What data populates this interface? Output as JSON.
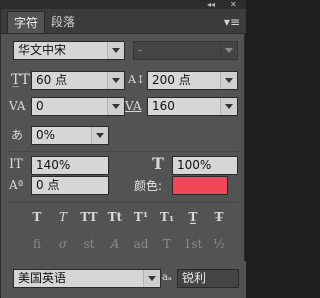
{
  "window": {
    "collapse_glyph": "◂◂",
    "close_glyph": "✕",
    "menu_glyph": "▾≡"
  },
  "tabs": [
    {
      "label": "字符"
    },
    {
      "label": "段落"
    }
  ],
  "font": {
    "family_value": "华文中宋",
    "style_value": "-",
    "size_value": "60 点",
    "leading_value": "200 点",
    "kerning_value": "0",
    "tracking_value": "160",
    "tsume_value": "0%",
    "vscale_value": "140%",
    "hscale_value": "100%",
    "baseline_value": "0 点",
    "color_label": "颜色:",
    "color_hex": "#f04657"
  },
  "icons": {
    "size": "T̲T",
    "leading": "A↕",
    "kerning": "VA",
    "tracking": "VA",
    "tsume": "あ",
    "vscale": "IT",
    "hscale": "T",
    "baseline": "Aª"
  },
  "style_buttons": [
    {
      "glyph": "T"
    },
    {
      "glyph": "T"
    },
    {
      "glyph": "TT"
    },
    {
      "glyph": "Tt"
    },
    {
      "glyph": "T¹"
    },
    {
      "glyph": "T₁"
    },
    {
      "glyph": "T̲"
    },
    {
      "glyph": "T̶"
    }
  ],
  "opentype_buttons": [
    {
      "glyph": "fi"
    },
    {
      "glyph": "σ"
    },
    {
      "glyph": "st"
    },
    {
      "glyph": "A"
    },
    {
      "glyph": "ad"
    },
    {
      "glyph": "T"
    },
    {
      "glyph": "1st"
    },
    {
      "glyph": "½"
    }
  ],
  "bottom": {
    "language_value": "美国英语",
    "aa_value": "锐利",
    "aa_prefix": "aₐ"
  }
}
